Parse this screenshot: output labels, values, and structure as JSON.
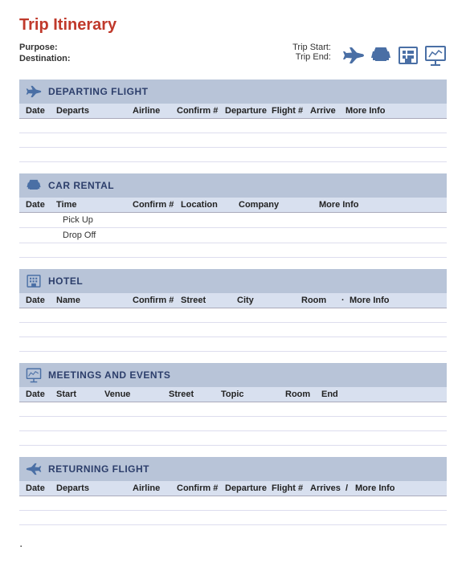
{
  "page": {
    "title": "Trip Itinerary",
    "purpose_label": "Purpose:",
    "destination_label": "Destination:",
    "trip_start_label": "Trip Start:",
    "trip_end_label": "Trip End:"
  },
  "sections": {
    "departing": {
      "title": "DEPARTING FLIGHT",
      "columns": [
        "Date",
        "Departs",
        "Airline",
        "Confirm #",
        "Departure",
        "Flight #",
        "Arrive",
        "More Info"
      ]
    },
    "car_rental": {
      "title": "CAR RENTAL",
      "columns": [
        "Date",
        "Time",
        "Confirm #",
        "Location",
        "Company",
        "More Info"
      ],
      "subrows": [
        "Pick Up",
        "Drop Off"
      ]
    },
    "hotel": {
      "title": "HOTEL",
      "columns": [
        "Date",
        "Name",
        "Confirm #",
        "Street",
        "City",
        "Room",
        "·",
        "More Info"
      ]
    },
    "meetings": {
      "title": "MEETINGS AND EVENTS",
      "columns": [
        "Date",
        "Start",
        "Venue",
        "Street",
        "Topic",
        "Room",
        "End"
      ]
    },
    "returning": {
      "title": "RETURNING FLIGHT",
      "columns": [
        "Date",
        "Departs",
        "Airline",
        "Confirm #",
        "Departure",
        "Flight #",
        "Arrives",
        "/",
        "More Info"
      ]
    }
  }
}
